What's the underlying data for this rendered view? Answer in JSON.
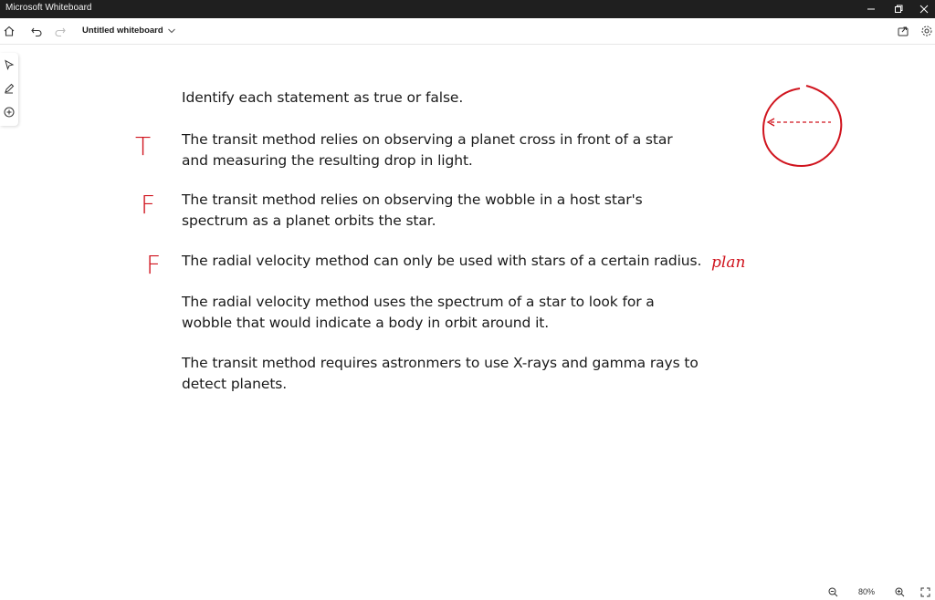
{
  "window": {
    "app_title": "Microsoft Whiteboard"
  },
  "toolbar": {
    "board_title": "Untitled whiteboard",
    "icons": [
      "home-icon",
      "undo-icon",
      "redo-icon",
      "chevron-down-icon",
      "share-icon",
      "settings-icon"
    ]
  },
  "tool_rail": {
    "icons": [
      "select-icon",
      "pen-icon",
      "add-icon"
    ]
  },
  "content": {
    "instruction": "Identify each statement as true or false.",
    "statements": [
      {
        "lines": [
          "The transit method relies on observing a planet cross in front of a star",
          "and measuring the resulting drop in light."
        ],
        "mark": "T"
      },
      {
        "lines": [
          "The transit method relies on observing the wobble in a host star's",
          "spectrum as a planet orbits the star."
        ],
        "mark": "F"
      },
      {
        "lines": [
          "The radial velocity method can only be used with stars of a certain radius."
        ],
        "mark": "F"
      },
      {
        "lines": [
          "The radial velocity method uses the spectrum of a star to look for a",
          "wobble that would indicate a body in orbit around it."
        ],
        "mark": ""
      },
      {
        "lines": [
          "The transit method requires astronmers to use X-rays and gamma rays to",
          "detect planets."
        ],
        "mark": ""
      }
    ],
    "annotation_note": "plan",
    "ink_color": "#d0141e"
  },
  "zoom": {
    "level": "80%"
  }
}
